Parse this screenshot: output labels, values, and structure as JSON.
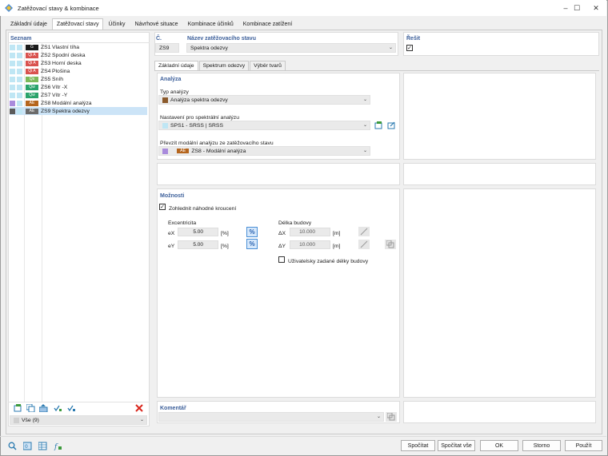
{
  "window": {
    "title": "Zatěžovací stavy & kombinace"
  },
  "tabs": [
    "Základní údaje",
    "Zatěžovací stavy",
    "Účinky",
    "Návrhové situace",
    "Kombinace účinků",
    "Kombinace zatížení"
  ],
  "list": {
    "header": "Seznam",
    "items": [
      {
        "tag": "G",
        "tag_color": "#1a1a1a",
        "id": "ZS1",
        "name": "Vlastní tíha"
      },
      {
        "tag": "Qi A",
        "tag_color": "#d9534f",
        "id": "ZS2",
        "name": "Spodní deska"
      },
      {
        "tag": "Qi A",
        "tag_color": "#d9534f",
        "id": "ZS3",
        "name": "Horní deska"
      },
      {
        "tag": "Qi A",
        "tag_color": "#d9534f",
        "id": "ZS4",
        "name": "Plošina"
      },
      {
        "tag": "Qs",
        "tag_color": "#7cba5a",
        "id": "ZS5",
        "name": "Sníh"
      },
      {
        "tag": "Qw",
        "tag_color": "#2aa36b",
        "id": "ZS6",
        "name": "Vítr -X"
      },
      {
        "tag": "Qw",
        "tag_color": "#2aa36b",
        "id": "ZS7",
        "name": "Vítr -Y"
      },
      {
        "tag": "AE",
        "tag_color": "#b5651d",
        "id": "ZS8",
        "name": "Modální analýza"
      },
      {
        "tag": "AE",
        "tag_color": "#6b6b6b",
        "id": "ZS9",
        "name": "Spektra odezvy"
      }
    ],
    "filter": "Vše (9)"
  },
  "no": {
    "label": "Č.",
    "value": "ZS9"
  },
  "name_field": {
    "label": "Název zatěžovacího stavu",
    "value": "Spektra odezvy"
  },
  "solve": {
    "label": "Řešit"
  },
  "subtabs": [
    "Základní údaje",
    "Spektrum odezvy",
    "Výběr tvarů"
  ],
  "analysis": {
    "header": "Analýza",
    "type_label": "Typ analýzy",
    "type_value": "Analýza spektra odezvy",
    "settings_label": "Nastavení pro spektrální analýzu",
    "settings_value": "SPS1 - SRSS | SRSS",
    "modal_label": "Převzít modální analýzu ze zatěžovacího stavu",
    "modal_tag": "AE",
    "modal_value": "ZS8 - Modální analýza"
  },
  "options": {
    "header": "Možnosti",
    "torsion_label": "Zohlednit náhodné kroucení",
    "ecc_label": "Excentricita",
    "ex_label": "eX",
    "ex_value": "5.00",
    "ey_label": "eY",
    "ey_value": "5.00",
    "unit_pct": "[%]",
    "len_label": "Délka budovy",
    "dx_label": "ΔX",
    "dx_value": "10.000",
    "dy_label": "ΔY",
    "dy_value": "10.000",
    "unit_m": "[m]",
    "user_len_label": "Uživatelsky zadané délky budovy"
  },
  "comment": {
    "label": "Komentář"
  },
  "buttons": {
    "calc": "Spočítat",
    "calc_all": "Spočítat vše",
    "ok": "OK",
    "cancel": "Storno",
    "apply": "Použít"
  },
  "colors": {
    "accent": "#3c5f9a",
    "selection": "#cce4f7"
  }
}
